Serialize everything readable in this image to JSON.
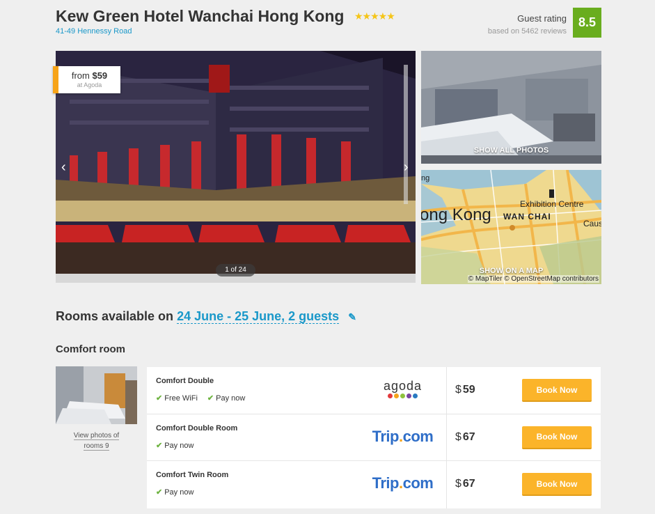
{
  "hotel": {
    "name": "Kew Green Hotel Wanchai Hong Kong",
    "stars": "★★★★★",
    "address": "41-49 Hennessy Road"
  },
  "rating": {
    "label": "Guest rating",
    "reviews": "based on 5462 reviews",
    "score": "8.5",
    "color": "#69ad1e"
  },
  "gallery": {
    "price_from": "from",
    "price_currency": "$",
    "price_value": "59",
    "price_source": "at Agoda",
    "prev_icon": "chevron-left-icon",
    "next_icon": "chevron-right-icon",
    "counter": "1 of 24",
    "show_all_label": "SHOW ALL PHOTOS",
    "map_label": "SHOW ON A MAP",
    "map_attribution": "© MapTiler © OpenStreetMap contributors",
    "map_text_1": "Exhibition Centre",
    "map_text_2": "WAN CHAI",
    "map_text_3": "ong Kong",
    "map_text_4": "Caus",
    "map_text_5": "ng"
  },
  "rooms": {
    "heading_prefix": "Rooms available on",
    "dates": "24 June - 25 June, 2 guests",
    "edit_icon": "pencil-icon"
  },
  "category": {
    "title": "Comfort room",
    "view_photos_line1": "View photos of",
    "view_photos_line2": "rooms 9"
  },
  "offers": [
    {
      "name": "Comfort Double",
      "features": [
        "Free WiFi",
        "Pay now"
      ],
      "provider": "agoda",
      "currency": "$",
      "price": "59",
      "button": "Book Now"
    },
    {
      "name": "Comfort Double Room",
      "features": [
        "Pay now"
      ],
      "provider": "Trip.com",
      "currency": "$",
      "price": "67",
      "button": "Book Now"
    },
    {
      "name": "Comfort Twin Room",
      "features": [
        "Pay now"
      ],
      "provider": "Trip.com",
      "currency": "$",
      "price": "67",
      "button": "Book Now"
    }
  ],
  "providers": {
    "agoda_text": "agoda",
    "trip_part1": "Trip",
    "trip_part2": ".",
    "trip_part3": "com"
  },
  "colors": {
    "accent_blue": "#1a98c9",
    "button_orange": "#fbb42a",
    "price_tag_accent": "#f7a418",
    "check_green": "#6db33f"
  }
}
